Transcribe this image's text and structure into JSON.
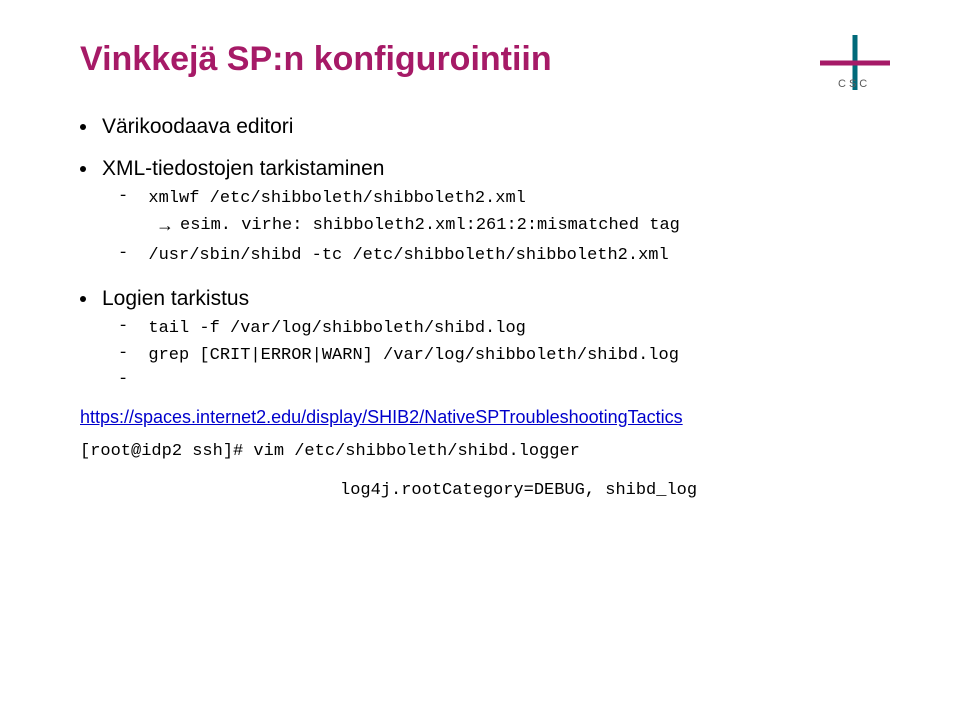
{
  "logo": {
    "csc": "C S C"
  },
  "title": "Vinkkejä SP:n konfigurointiin",
  "b1": {
    "label": "Värikoodaava editori"
  },
  "b2": {
    "label": "XML-tiedostojen tarkistaminen",
    "s1": "xmlwf /etc/shibboleth/shibboleth2.xml",
    "arrow_line": "esim. virhe: shibboleth2.xml:261:2:mismatched tag",
    "s2": "/usr/sbin/shibd -tc /etc/shibboleth/shibboleth2.xml"
  },
  "b3": {
    "label": "Logien tarkistus",
    "s1": "tail -f /var/log/shibboleth/shibd.log",
    "s2": "grep [CRIT|ERROR|WARN] /var/log/shibboleth/shibd.log"
  },
  "link": {
    "text": "https://spaces.internet2.edu/display/SHIB2/NativeSPTroubleshootingTactics"
  },
  "code": {
    "l1": "[root@idp2 ssh]# vim /etc/shibboleth/shibd.logger",
    "l2": "log4j.rootCategory=DEBUG, shibd_log"
  }
}
